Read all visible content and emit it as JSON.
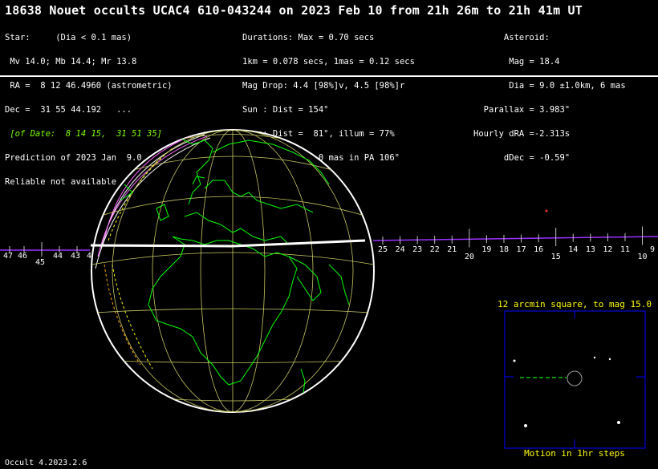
{
  "header": {
    "title": "18638 Nouet occults UCAC4 610-043244 on 2023 Feb 10 from 21h 26m to 21h 41m UT"
  },
  "star_info": [
    "Star:     (Dia < 0.1 mas)",
    " Mv 14.0; Mb 14.4; Mr 13.8",
    " RA =  8 12 46.4960 (astrometric)",
    "Dec =  31 55 44.192   ...",
    " [of Date:  8 14 15,  31 51 35]",
    "Prediction of 2023 Jan  9.0",
    "Reliable not available"
  ],
  "event_info": [
    "Durations: Max = 0.70 secs",
    "1km = 0.078 secs, 1mas = 0.12 secs",
    "Mag Drop: 4.4 [98%]v, 4.5 [98%]r",
    "Sun : Dist = 154°",
    "Moon: Dist =  81°, illum = 77%",
    "Error 15.0 x 4.0 mas in PA 106°"
  ],
  "asteroid_info": [
    "      Asteroid:",
    "       Mag = 18.4",
    "       Dia = 9.0 ±1.0km, 6 mas",
    "  Parallax = 3.983\"",
    "Hourly dRA =-2.313s",
    "      dDec = -0.59\""
  ],
  "time_ticks": {
    "left": [
      "47",
      "46",
      "45",
      "44",
      "43",
      "42"
    ],
    "right": [
      "25",
      "24",
      "23",
      "22",
      "21",
      "20",
      "19",
      "18",
      "17",
      "16",
      "15",
      "14",
      "13",
      "12",
      "11",
      "10",
      "9"
    ]
  },
  "inset": {
    "title": "12 arcmin square, to mag 15.0",
    "caption": "Motion in 1hr steps"
  },
  "footer": {
    "version": "Occult 4.2023.2.6"
  },
  "colors": {
    "coastline": "#00ff00",
    "grid": "#c8c864",
    "path": "#ffffff",
    "inset_border": "#0000ff",
    "inset_text": "#ffff00",
    "axis": "#9b30ff"
  }
}
